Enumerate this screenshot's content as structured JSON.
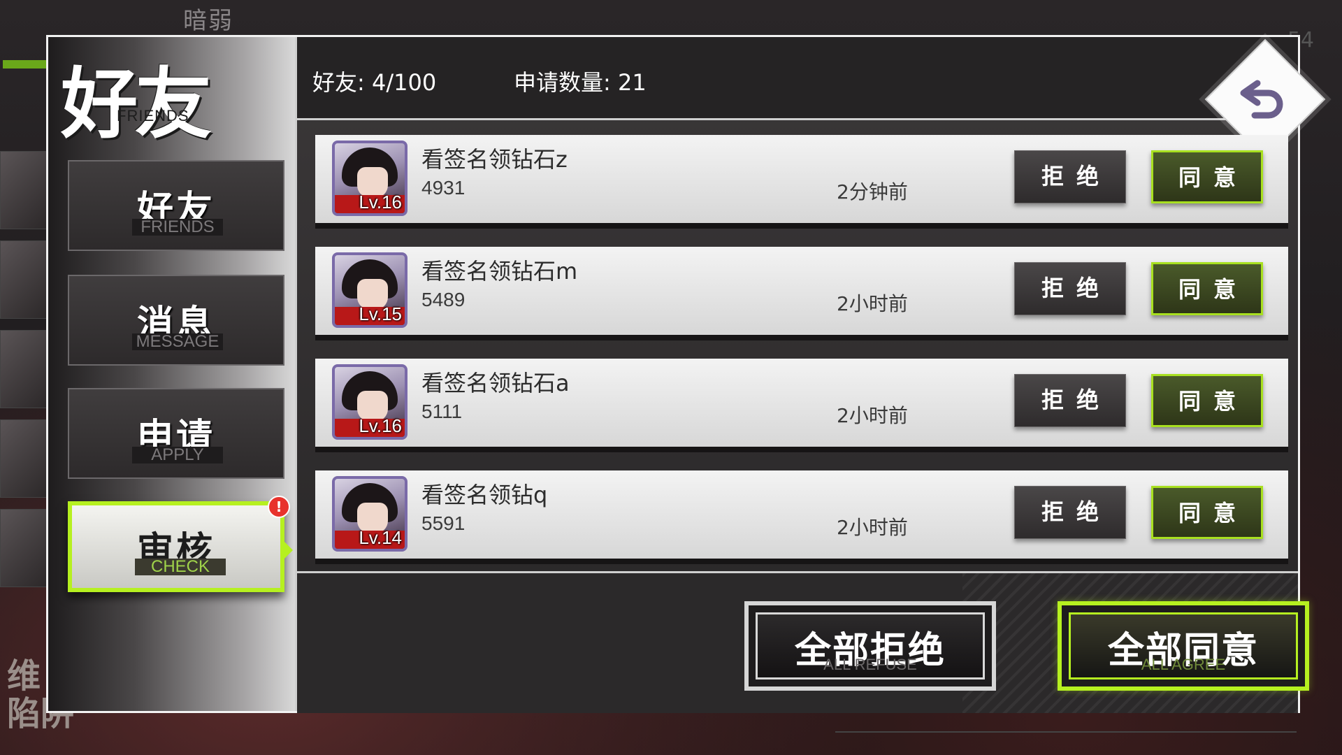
{
  "background": {
    "top_text": "暗弱",
    "corner_number": "54",
    "side_text": "维\n陷阱"
  },
  "sidebar": {
    "title_cn": "好友",
    "title_en": "FRIENDS",
    "tabs": [
      {
        "cn": "好友",
        "en": "FRIENDS"
      },
      {
        "cn": "消息",
        "en": "MESSAGE"
      },
      {
        "cn": "申请",
        "en": "APPLY"
      },
      {
        "cn": "审核",
        "en": "CHECK",
        "badge": "!"
      }
    ]
  },
  "header": {
    "friends_label": "好友: 4/100",
    "requests_label": "申请数量: 21",
    "back_icon": "undo-arrow-icon"
  },
  "requests": [
    {
      "name": "看签名领钻石z",
      "id": "4931",
      "level": "Lv.16",
      "time": "2分钟前",
      "refuse": "拒绝",
      "agree": "同意"
    },
    {
      "name": "看签名领钻石m",
      "id": "5489",
      "level": "Lv.15",
      "time": "2小时前",
      "refuse": "拒绝",
      "agree": "同意"
    },
    {
      "name": "看签名领钻石a",
      "id": "5111",
      "level": "Lv.16",
      "time": "2小时前",
      "refuse": "拒绝",
      "agree": "同意"
    },
    {
      "name": "看签名领钻q",
      "id": "5591",
      "level": "Lv.14",
      "time": "2小时前",
      "refuse": "拒绝",
      "agree": "同意"
    }
  ],
  "actions": {
    "refuse_all_cn": "全部拒绝",
    "refuse_all_en": "ALL REFUSE",
    "agree_all_cn": "全部同意",
    "agree_all_en": "ALL AGREE"
  },
  "colors": {
    "accent_green": "#b6f020",
    "badge_red": "#e8322c",
    "panel_border": "#f2f2f2"
  }
}
